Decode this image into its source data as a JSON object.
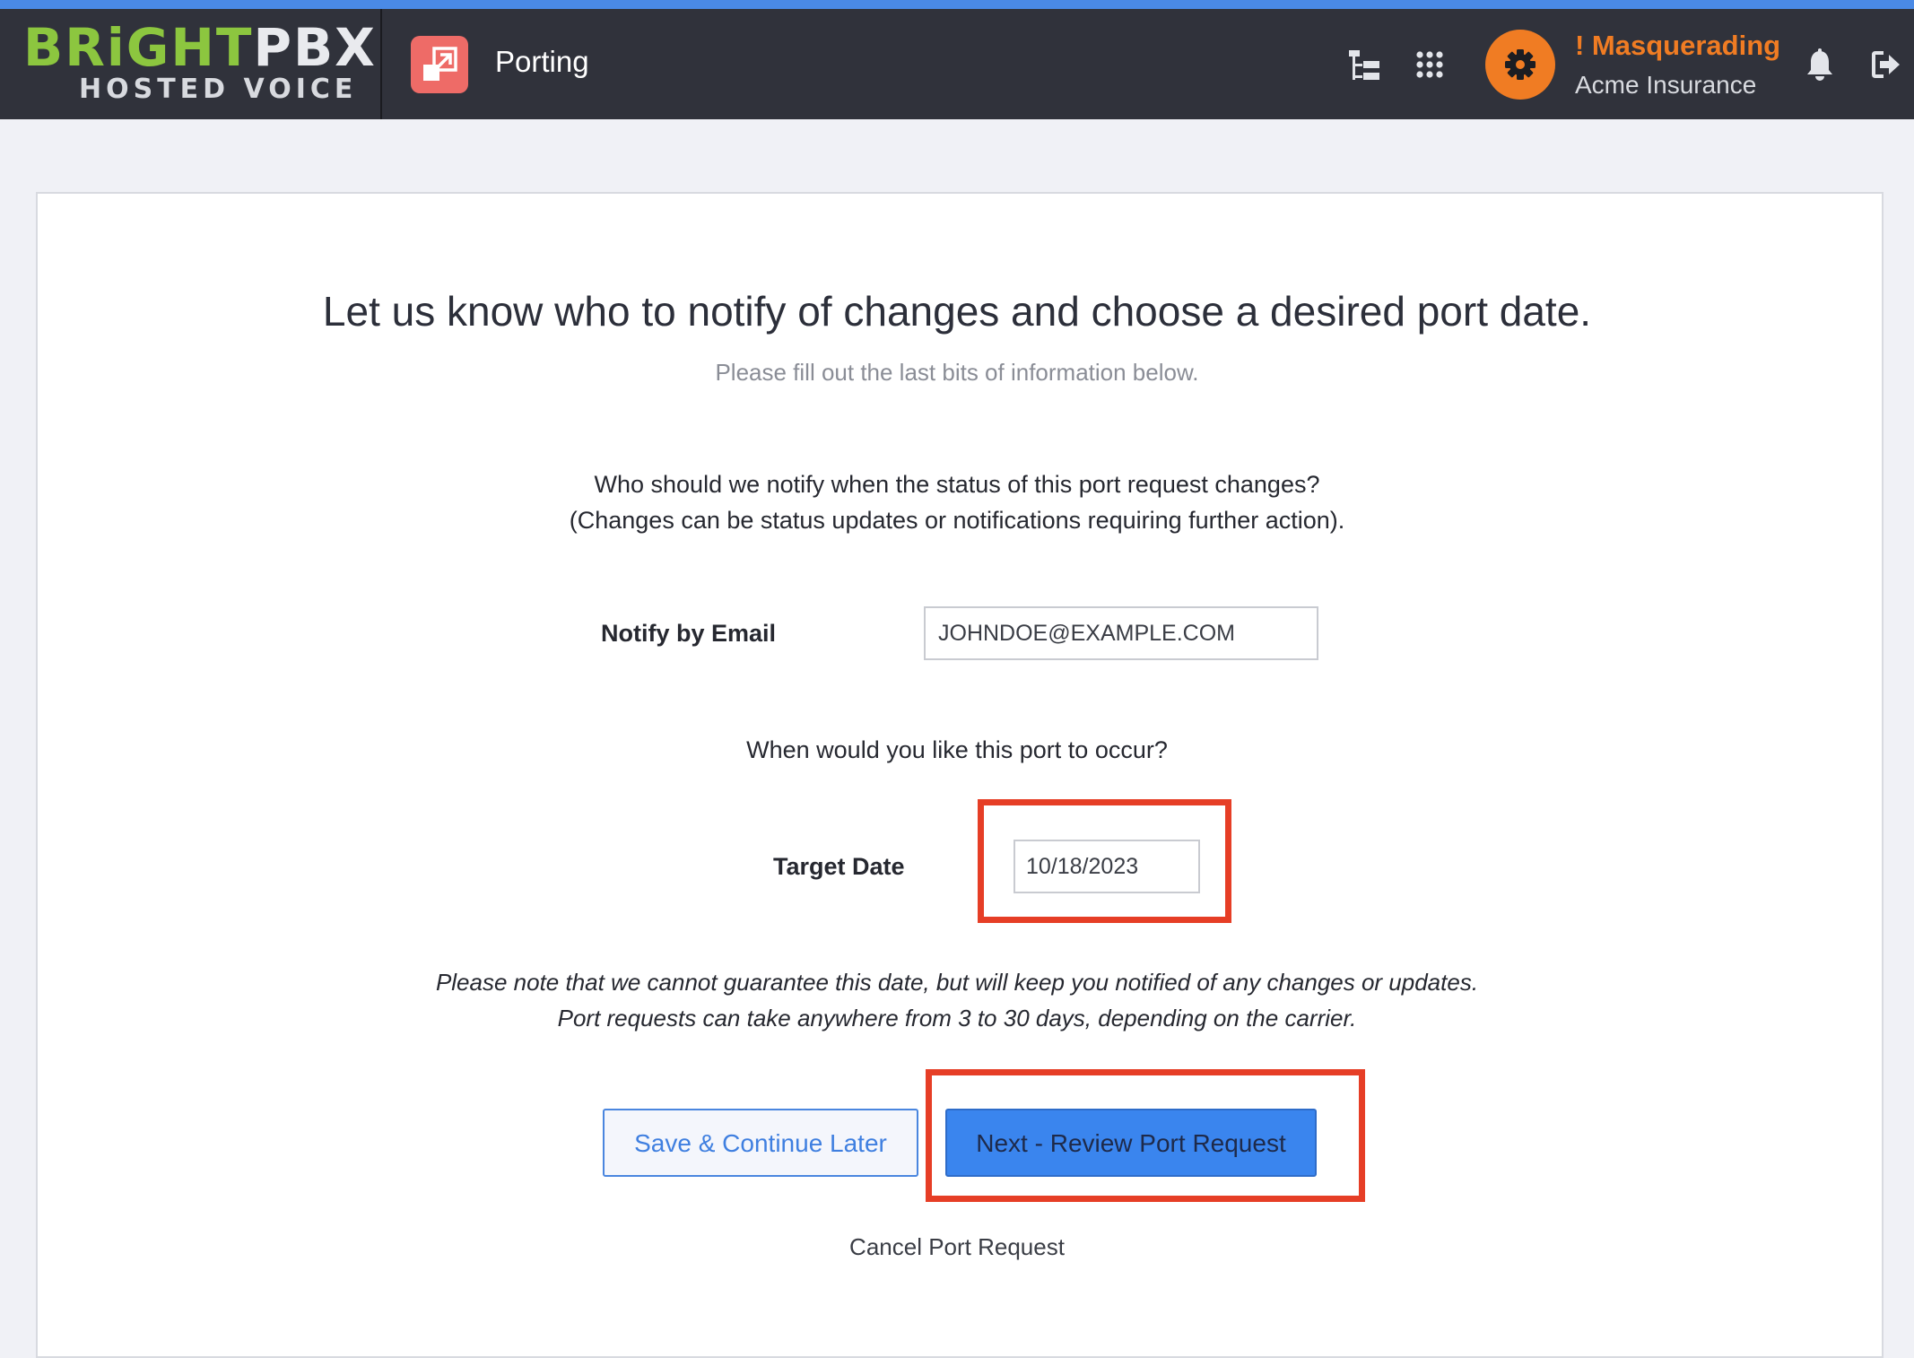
{
  "brand": {
    "name_part1": "BRiGHT",
    "name_part2": "PBX",
    "tagline": "HOSTED VOICE"
  },
  "header": {
    "app_title": "Porting",
    "app_icon": "porting-arrow-icon",
    "masquerade_label": "! Masquerading",
    "company_name": "Acme Insurance",
    "icons": [
      "hierarchy-icon",
      "apps-grid-icon",
      "gear-icon",
      "bell-icon",
      "logout-icon"
    ]
  },
  "main": {
    "heading": "Let us know who to notify of changes and choose a desired port date.",
    "subheading": "Please fill out the last bits of information below.",
    "notify_question_line1": "Who should we notify when the status of this port request changes?",
    "notify_question_line2": "(Changes can be status updates or notifications requiring further action).",
    "email_label": "Notify by Email",
    "email_value": "JOHNDOE@EXAMPLE.COM",
    "date_question": "When would you like this port to occur?",
    "target_date_label": "Target Date",
    "target_date_value": "10/18/2023",
    "note_line1": "Please note that we cannot guarantee this date, but will keep you notified of any changes or updates.",
    "note_line2": "Port requests can take anywhere from 3 to 30 days, depending on the carrier.",
    "save_button_label": "Save & Continue Later",
    "next_button_label": "Next - Review Port Request",
    "cancel_link_label": "Cancel Port Request"
  },
  "colors": {
    "top_strip": "#4a8ae6",
    "navbar_bg": "#30323b",
    "brand_green": "#8cc63f",
    "masquerade_orange": "#f07c23",
    "app_icon_bg": "#ee6b67",
    "primary_button": "#3a85ee",
    "highlight_red": "#e63e26",
    "page_bg": "#f0f1f6"
  }
}
